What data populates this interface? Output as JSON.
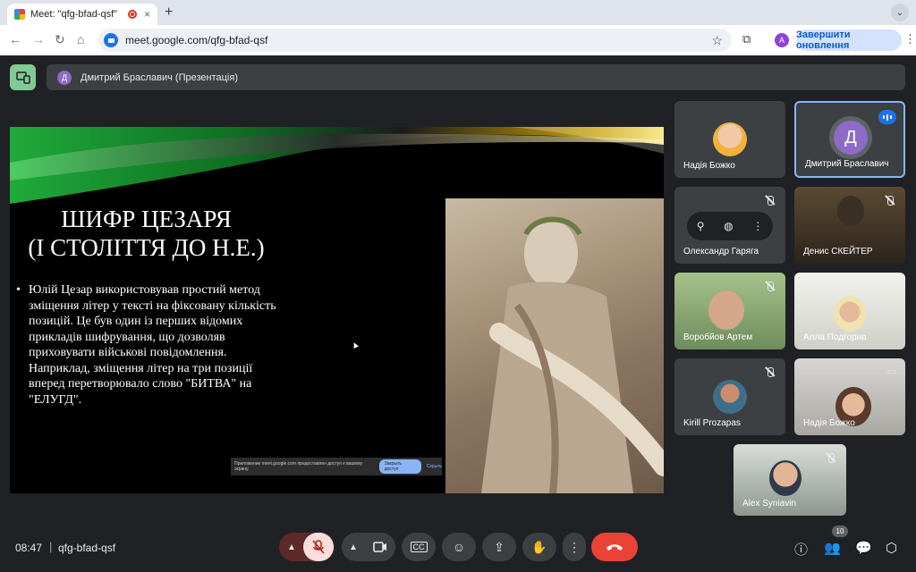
{
  "browser": {
    "tab_title": "Meet: \"qfg-bfad-qsf\"",
    "tab_close": "×",
    "new_tab": "+",
    "url": "meet.google.com/qfg-bfad-qsf",
    "profile_letter": "A",
    "update_button": "Завершити оновлення"
  },
  "presentation": {
    "presenter_avatar": "Д",
    "banner": "Дмитрий Браславич (Презентація)"
  },
  "slide": {
    "title_line1": "ШИФР ЦЕЗАРЯ",
    "title_line2": "(І СТОЛІТТЯ ДО Н.Е.)",
    "bullet": "•",
    "body": "Юлій Цезар використовував простий метод зміщення літер у тексті на фіксовану кількість позицій. Це був один із перших відомих прикладів шифрування, що дозволяв приховувати військові повідомлення. Наприклад, зміщення літер на три позиції вперед перетворювало слово \"БИТВА\" на \"ЕЛУГД\".",
    "share_notice": "Приложение meet.google.com предоставлен доступ к вашему экрану.",
    "share_stop": "Закрыть доступ",
    "share_hide": "Скрыть"
  },
  "participants": [
    {
      "name": "Надія Божко",
      "muted": false
    },
    {
      "name": "Дмитрий Браславич",
      "avatar": "Д",
      "speaking": true
    },
    {
      "name": "Олександр Гаряга",
      "muted": true
    },
    {
      "name": "Денис СКЕЙТЕР",
      "muted": true
    },
    {
      "name": "Воробйов Артем",
      "muted": true
    },
    {
      "name": "Алла Подгорна",
      "muted": true
    },
    {
      "name": "Kirill Prozapas",
      "muted": true
    },
    {
      "name": "Надія Божко",
      "muted": false
    },
    {
      "name": "Alex Syniavin",
      "muted": true
    }
  ],
  "footer": {
    "time": "08:47",
    "separator": "|",
    "meeting_code": "qfg-bfad-qsf",
    "participant_count": "10"
  },
  "colors": {
    "background": "#202124",
    "tile": "#3c4043",
    "end_call": "#ea4335",
    "mic_off": "#f9dedc",
    "accent": "#1a73e8"
  }
}
